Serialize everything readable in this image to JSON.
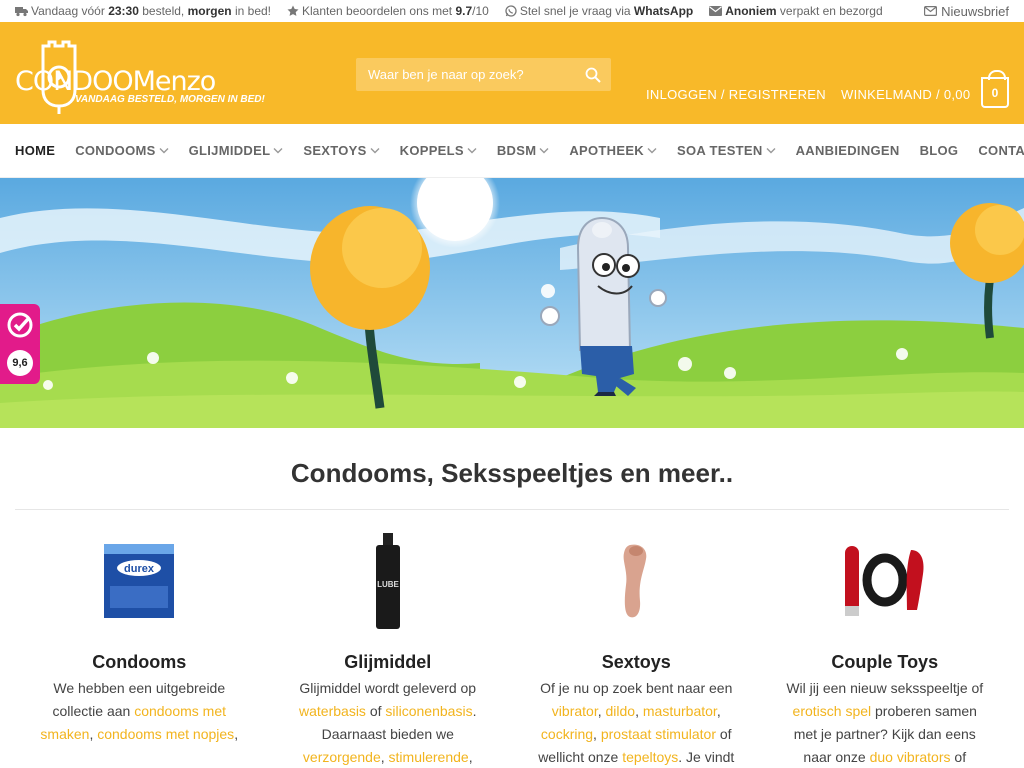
{
  "topbar": {
    "delivery_pre": "Vandaag vóór",
    "delivery_time": "23:30",
    "delivery_mid": "besteld,",
    "delivery_bold": "morgen",
    "delivery_post": "in bed!",
    "rating_pre": "Klanten beoordelen ons met",
    "rating_score": "9.7",
    "rating_post": "/10",
    "whatsapp_pre": "Stel snel je vraag via",
    "whatsapp_bold": "WhatsApp",
    "anon_bold": "Anoniem",
    "anon_post": "verpakt en bezorgd",
    "newsletter": "Nieuwsbrief"
  },
  "header": {
    "logo_text": "CONDOOMenzo",
    "logo_tagline": "VANDAAG BESTELD, MORGEN IN BED!",
    "search_placeholder": "Waar ben je naar op zoek?",
    "login": "INLOGGEN / REGISTREREN",
    "cart_label": "WINKELMAND / 0,00",
    "cart_count": "0"
  },
  "nav": {
    "items": [
      {
        "label": "HOME",
        "dropdown": false
      },
      {
        "label": "CONDOOMS",
        "dropdown": true
      },
      {
        "label": "GLIJMIDDEL",
        "dropdown": true
      },
      {
        "label": "SEXTOYS",
        "dropdown": true
      },
      {
        "label": "KOPPELS",
        "dropdown": true
      },
      {
        "label": "BDSM",
        "dropdown": true
      },
      {
        "label": "APOTHEEK",
        "dropdown": true
      },
      {
        "label": "SOA TESTEN",
        "dropdown": true
      },
      {
        "label": "AANBIEDINGEN",
        "dropdown": false
      },
      {
        "label": "BLOG",
        "dropdown": false
      },
      {
        "label": "CONTACT",
        "dropdown": false
      }
    ]
  },
  "badge": {
    "score": "9,6"
  },
  "main": {
    "title": "Condooms, Seksspeeltjes en meer..",
    "categories": [
      {
        "title": "Condooms",
        "t1": "We hebben een uitgebreide collectie aan",
        "l1": "condooms met smaken",
        "t2": ",",
        "l2": "condooms met nopjes",
        "t3": ","
      },
      {
        "title": "Glijmiddel",
        "t1": "Glijmiddel wordt geleverd op",
        "l1": "waterbasis",
        "t2": "of",
        "l2": "siliconenbasis",
        "t3": ". Daarnaast bieden we",
        "l3": "verzorgende",
        "t4": ",",
        "l4": "stimulerende",
        "t5": ","
      },
      {
        "title": "Sextoys",
        "t1": "Of je nu op zoek bent naar een",
        "l1": "vibrator",
        "t2": ",",
        "l2": "dildo",
        "t3": ",",
        "l3": "masturbator",
        "t4": ",",
        "l4": "cockring",
        "t5": ",",
        "l5": "prostaat stimulator",
        "t6": "of wellicht onze",
        "l6": "tepeltoys",
        "t7": ". Je vindt"
      },
      {
        "title": "Couple Toys",
        "t1": "Wil jij een nieuw seksspeeltje of",
        "l1": "erotisch spel",
        "t2": "proberen samen met je partner? Kijk dan eens naar onze",
        "l2": "duo vibrators",
        "t3": "of"
      }
    ]
  },
  "colors": {
    "brand": "#f8b929",
    "link": "#f2b41e",
    "badge": "#e21b8a"
  }
}
